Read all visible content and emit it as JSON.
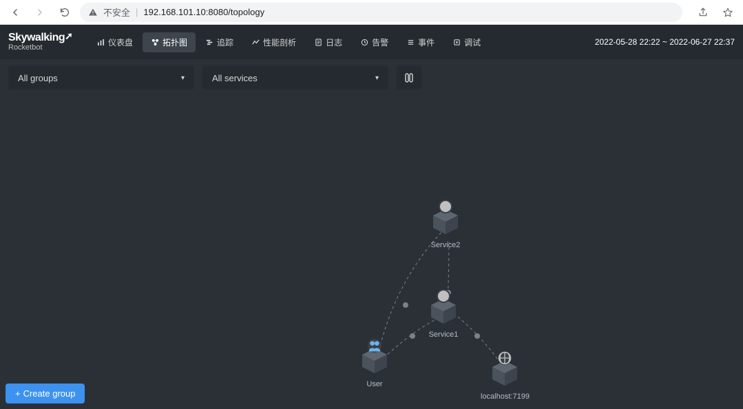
{
  "browser": {
    "insecure_label": "不安全",
    "url": "192.168.101.10:8080/topology"
  },
  "brand": {
    "title_a": "Sky",
    "title_b": "walking",
    "subtitle": "Rocketbot"
  },
  "menu": {
    "dashboard": "仪表盘",
    "topology": "拓扑图",
    "trace": "追踪",
    "profile": "性能剖析",
    "log": "日志",
    "alarm": "告警",
    "event": "事件",
    "debug": "调试"
  },
  "time_range": "2022-05-28 22:22 ~ 2022-06-27 22:37",
  "filters": {
    "groups": "All groups",
    "services": "All services"
  },
  "nodes": {
    "service2": "Service2",
    "service1": "Service1",
    "user": "User",
    "localhost": "localhost:7199"
  },
  "buttons": {
    "create_group": "Create group"
  }
}
